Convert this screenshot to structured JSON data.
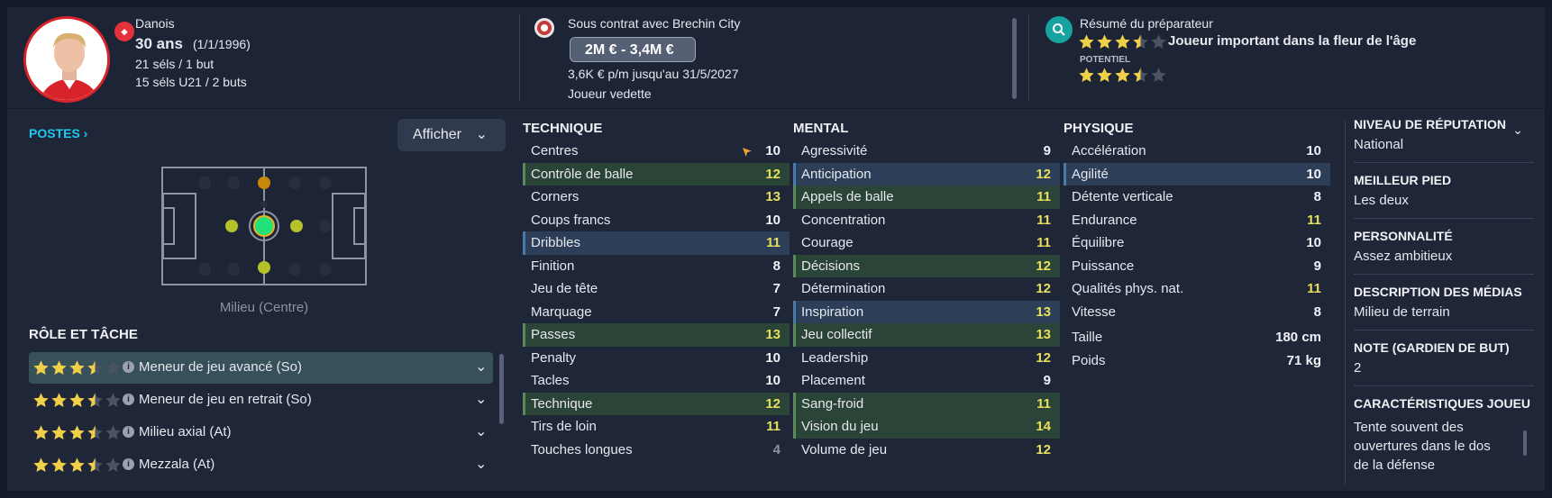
{
  "header": {
    "nationality": "Danois",
    "age": "30 ans",
    "dob": "(1/1/1996)",
    "caps": "21 séls / 1 but",
    "u21_caps": "15 séls U21 / 2 buts",
    "contract_label": "Sous contrat avec Brechin City",
    "value": "2M € - 3,4M €",
    "wage": "3,6K € p/m jusqu'au 31/5/2027",
    "status": "Joueur vedette",
    "scout_title": "Résumé du préparateur",
    "ability_stars": 3.5,
    "scout_summary": "Joueur important dans la fleur de l'âge",
    "potential_label": "POTENTIEL",
    "potential_stars": 3.5
  },
  "positions": {
    "title": "POSTES",
    "show_button": "Afficher",
    "position_label": "Milieu (Centre)"
  },
  "roles": {
    "title": "RÔLE ET TÂCHE",
    "items": [
      {
        "label": "Meneur de jeu avancé (So)",
        "stars": 3.5
      },
      {
        "label": "Meneur de jeu en retrait (So)",
        "stars": 3.5
      },
      {
        "label": "Milieu axial (At)",
        "stars": 3.5
      },
      {
        "label": "Mezzala (At)",
        "stars": 3.5
      }
    ]
  },
  "technique": {
    "title": "TECHNIQUE",
    "rows": [
      {
        "name": "Centres",
        "value": "10"
      },
      {
        "name": "Contrôle de balle",
        "value": "12"
      },
      {
        "name": "Corners",
        "value": "13"
      },
      {
        "name": "Coups francs",
        "value": "10"
      },
      {
        "name": "Dribbles",
        "value": "11"
      },
      {
        "name": "Finition",
        "value": "8"
      },
      {
        "name": "Jeu de tête",
        "value": "7"
      },
      {
        "name": "Marquage",
        "value": "7"
      },
      {
        "name": "Passes",
        "value": "13"
      },
      {
        "name": "Penalty",
        "value": "10"
      },
      {
        "name": "Tacles",
        "value": "10"
      },
      {
        "name": "Technique",
        "value": "12"
      },
      {
        "name": "Tirs de loin",
        "value": "11"
      },
      {
        "name": "Touches longues",
        "value": "4"
      }
    ]
  },
  "mental": {
    "title": "MENTAL",
    "rows": [
      {
        "name": "Agressivité",
        "value": "9"
      },
      {
        "name": "Anticipation",
        "value": "12"
      },
      {
        "name": "Appels de balle",
        "value": "11"
      },
      {
        "name": "Concentration",
        "value": "11"
      },
      {
        "name": "Courage",
        "value": "11"
      },
      {
        "name": "Décisions",
        "value": "12"
      },
      {
        "name": "Détermination",
        "value": "12"
      },
      {
        "name": "Inspiration",
        "value": "13"
      },
      {
        "name": "Jeu collectif",
        "value": "13"
      },
      {
        "name": "Leadership",
        "value": "12"
      },
      {
        "name": "Placement",
        "value": "9"
      },
      {
        "name": "Sang-froid",
        "value": "11"
      },
      {
        "name": "Vision du jeu",
        "value": "14"
      },
      {
        "name": "Volume de jeu",
        "value": "12"
      }
    ]
  },
  "physique": {
    "title": "PHYSIQUE",
    "rows": [
      {
        "name": "Accélération",
        "value": "10"
      },
      {
        "name": "Agilité",
        "value": "10"
      },
      {
        "name": "Détente verticale",
        "value": "8"
      },
      {
        "name": "Endurance",
        "value": "11"
      },
      {
        "name": "Équilibre",
        "value": "10"
      },
      {
        "name": "Puissance",
        "value": "9"
      },
      {
        "name": "Qualités phys. nat.",
        "value": "11"
      },
      {
        "name": "Vitesse",
        "value": "8"
      }
    ],
    "height_label": "Taille",
    "height": "180 cm",
    "weight_label": "Poids",
    "weight": "71 kg"
  },
  "profile": {
    "reputation_title": "NIVEAU DE RÉPUTATION",
    "reputation": "National",
    "foot_title": "MEILLEUR PIED",
    "foot": "Les deux",
    "personality_title": "PERSONNALITÉ",
    "personality": "Assez ambitieux",
    "media_title": "DESCRIPTION DES MÉDIAS",
    "media": "Milieu de terrain",
    "gk_title": "NOTE (GARDIEN DE BUT)",
    "gk": "2",
    "traits_title": "CARACTÉRISTIQUES JOUEU",
    "traits": "Tente souvent des ouvertures dans le dos de la défense"
  },
  "colors": {
    "accent": "#1ec8f0",
    "highlight": "#e8e05a",
    "star": "#f0d048"
  }
}
